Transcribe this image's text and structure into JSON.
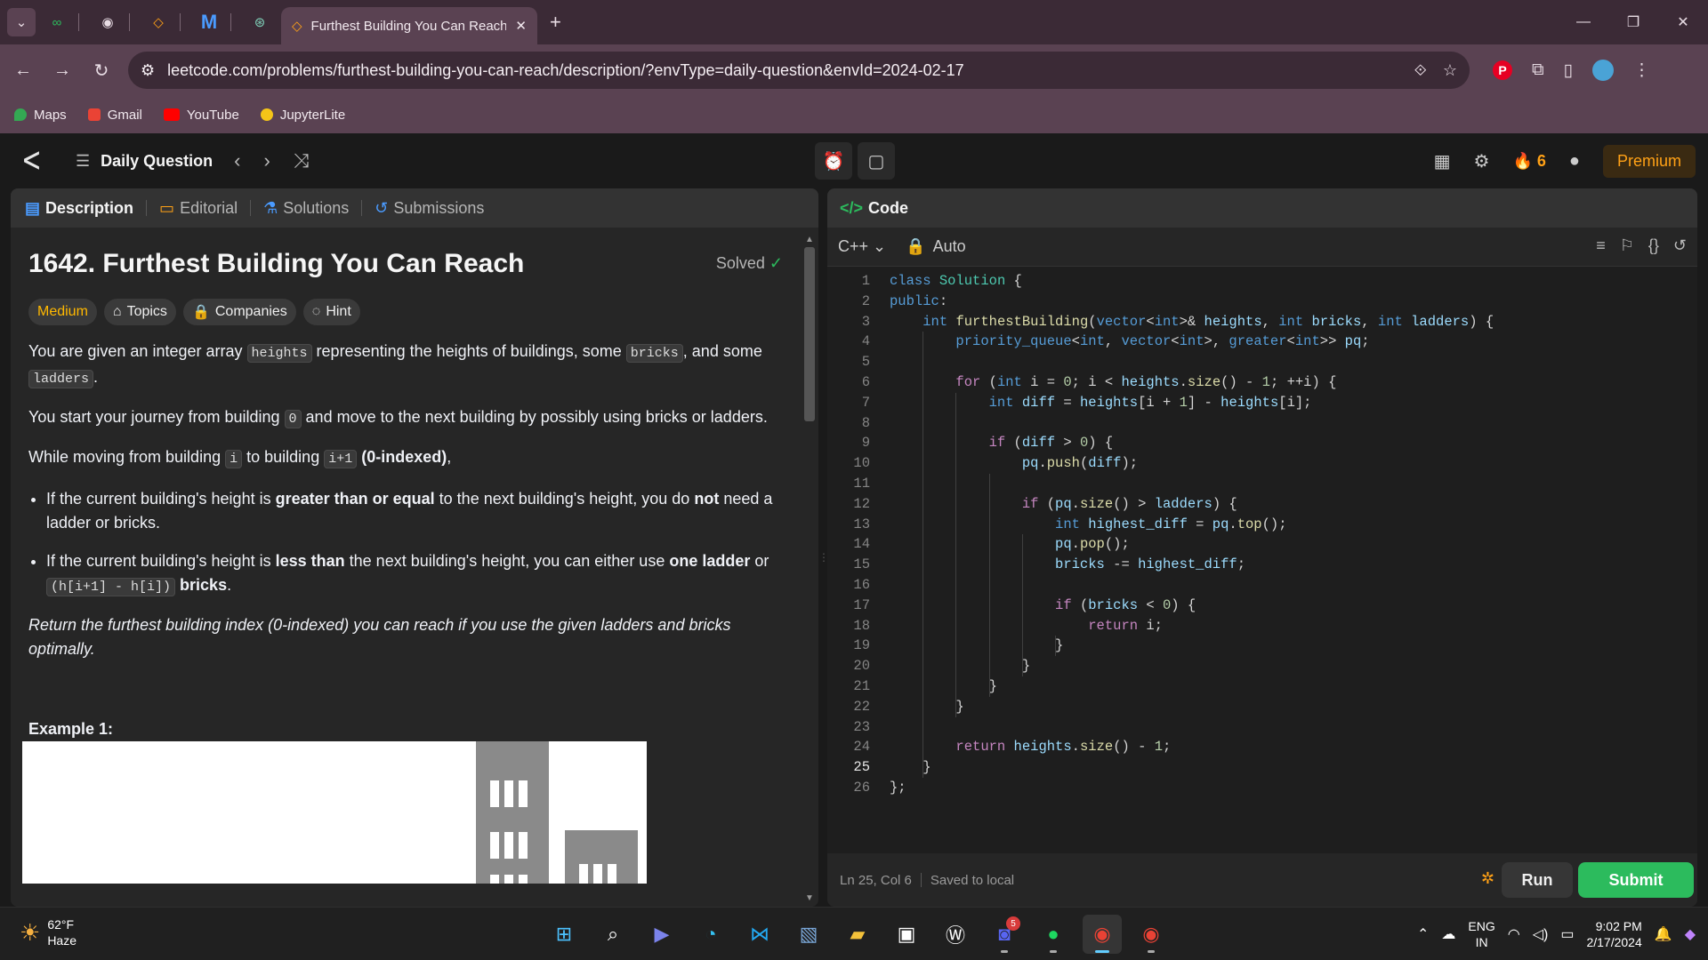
{
  "browser": {
    "tab_title": "Furthest Building You Can Reach",
    "url": "leetcode.com/problems/furthest-building-you-can-reach/description/?envType=daily-question&envId=2024-02-17",
    "bookmarks": [
      "Maps",
      "Gmail",
      "YouTube",
      "JupyterLite"
    ]
  },
  "header": {
    "daily_question": "Daily Question",
    "streak": "6",
    "premium": "Premium"
  },
  "left_tabs": [
    "Description",
    "Editorial",
    "Solutions",
    "Submissions"
  ],
  "problem": {
    "title": "1642. Furthest Building You Can Reach",
    "status": "Solved",
    "difficulty": "Medium",
    "chips": [
      "Topics",
      "Companies",
      "Hint"
    ],
    "p1_a": "You are given an integer array",
    "p1_code1": "heights",
    "p1_b": "representing the heights of buildings, some",
    "p1_code2": "bricks",
    "p1_c": ", and some",
    "p1_code3": "ladders",
    "p1_d": ".",
    "p2_a": "You start your journey from building",
    "p2_code": "0",
    "p2_b": "and move to the next building by possibly using bricks or ladders.",
    "p3_a": "While moving from building",
    "p3_code1": "i",
    "p3_b": "to building",
    "p3_code2": "i+1",
    "p3_bold": "(0-indexed)",
    "p3_c": ",",
    "b1_a": "If the current building's height is",
    "b1_bold1": "greater than or equal",
    "b1_b": "to the next building's height, you do",
    "b1_bold2": "not",
    "b1_c": "need a ladder or bricks.",
    "b2_a": "If the current building's height is",
    "b2_bold1": "less than",
    "b2_b": "the next building's height, you can either use",
    "b2_bold2": "one ladder",
    "b2_c": "or",
    "b2_code": "(h[i+1] - h[i])",
    "b2_bold3": "bricks",
    "b2_d": ".",
    "return_text": "Return the furthest building index (0-indexed) you can reach if you use the given ladders and bricks optimally.",
    "example_title": "Example 1:"
  },
  "editor": {
    "panel_title": "Code",
    "language": "C++",
    "mode": "Auto",
    "current_line": 25,
    "lines": [
      "class Solution {",
      "public:",
      "    int furthestBuilding(vector<int>& heights, int bricks, int ladders) {",
      "        priority_queue<int, vector<int>, greater<int>> pq;",
      "",
      "        for (int i = 0; i < heights.size() - 1; ++i) {",
      "            int diff = heights[i + 1] - heights[i];",
      "",
      "            if (diff > 0) {",
      "                pq.push(diff);",
      "",
      "                if (pq.size() > ladders) {",
      "                    int highest_diff = pq.top();",
      "                    pq.pop();",
      "                    bricks -= highest_diff;",
      "",
      "                    if (bricks < 0) {",
      "                        return i;",
      "                    }",
      "                }",
      "            }",
      "        }",
      "",
      "        return heights.size() - 1;",
      "    }",
      "};"
    ],
    "cursor_pos": "Ln 25, Col 6",
    "save_status": "Saved to local",
    "run_label": "Run",
    "submit_label": "Submit"
  },
  "taskbar": {
    "temp": "62°F",
    "weather": "Haze",
    "discord_badge": "5",
    "lang1": "ENG",
    "lang2": "IN",
    "time": "9:02 PM",
    "date": "2/17/2024"
  }
}
